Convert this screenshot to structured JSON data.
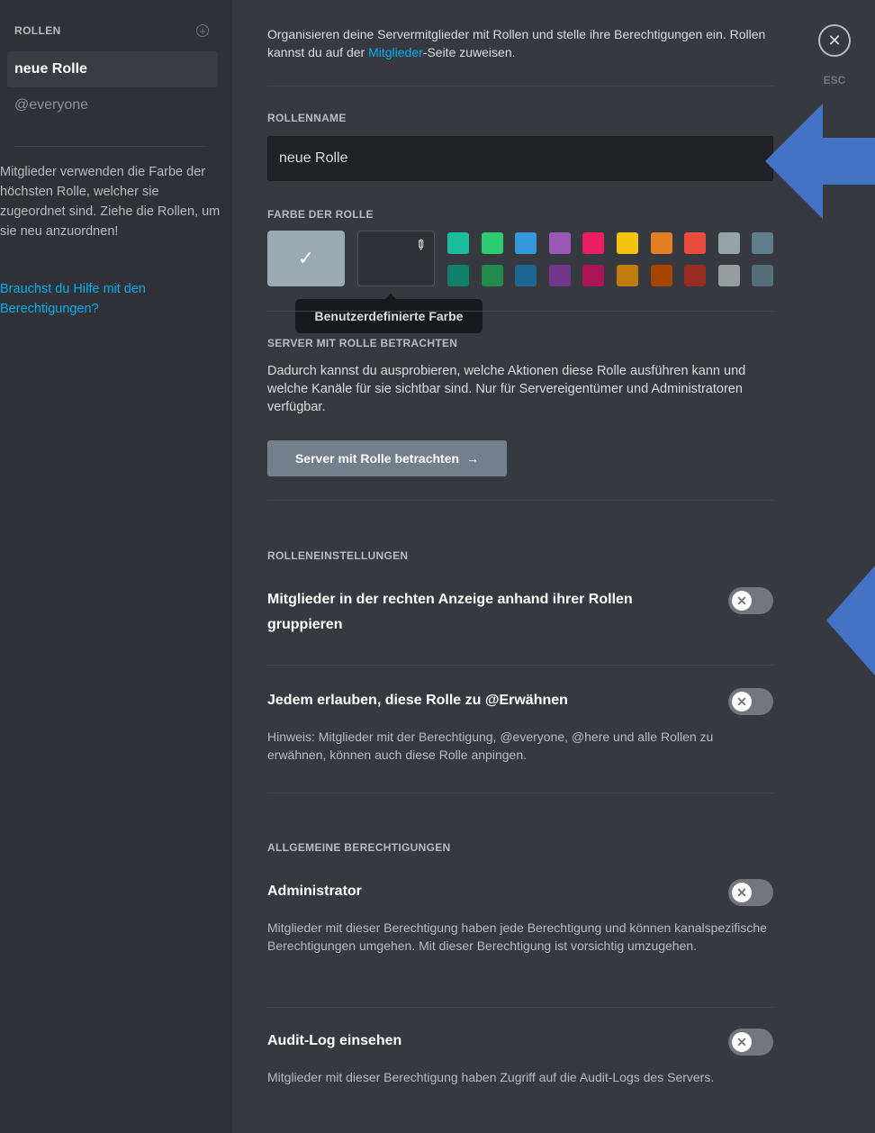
{
  "sidebar": {
    "title": "ROLLEN",
    "add_icon": "plus-circle-icon",
    "roles": [
      {
        "label": "neue Rolle",
        "active": true
      },
      {
        "label": "@everyone",
        "active": false
      }
    ],
    "help_text": "Mitglieder verwenden die Farbe der höchsten Rolle, welcher sie zugeordnet sind. Ziehe die Rollen, um sie neu anzuordnen!",
    "help_link": "Brauchst du Hilfe mit den Berechtigungen?"
  },
  "intro": {
    "text_before": "Organisieren deine Servermitglieder mit Rollen und stelle ihre Berechtigungen ein. Rollen kannst du auf der ",
    "link": "Mitglieder",
    "text_after": "-Seite zuweisen."
  },
  "role_name": {
    "label": "ROLLENNAME",
    "value": "neue Rolle"
  },
  "role_color": {
    "label": "FARBE DER ROLLE",
    "default_color": "#99aab5",
    "check_icon": "✓",
    "tooltip": "Benutzerdefinierte Farbe",
    "swatches_top": [
      "#1abc9c",
      "#2ecc71",
      "#3498db",
      "#9b59b6",
      "#e91e63",
      "#f1c40f",
      "#e67e22",
      "#e74c3c",
      "#95a5a6",
      "#607d8b"
    ],
    "swatches_bottom": [
      "#11806a",
      "#1f8b4c",
      "#206694",
      "#71368a",
      "#ad1457",
      "#c27c0e",
      "#a84300",
      "#992d22",
      "#979c9f",
      "#546e7a"
    ]
  },
  "view_as_role": {
    "label": "SERVER MIT ROLLE BETRACHTEN",
    "description": "Dadurch kannst du ausprobieren, welche Aktionen diese Rolle ausführen kann und welche Kanäle für sie sichtbar sind. Nur für Servereigentümer und Administratoren verfügbar.",
    "button": "Server mit Rolle betrachten",
    "button_arrow": "→"
  },
  "role_settings": {
    "label": "ROLLENEINSTELLUNGEN",
    "items": [
      {
        "title": "Mitglieder in der rechten Anzeige anhand ihrer Rollen gruppieren",
        "description": "",
        "enabled": false
      },
      {
        "title": "Jedem erlauben, diese Rolle zu @Erwähnen",
        "description": "Hinweis: Mitglieder mit der Berechtigung, @everyone, @here und alle Rollen zu erwähnen, können auch diese Rolle anpingen.",
        "enabled": false
      }
    ]
  },
  "general_permissions": {
    "label": "ALLGEMEINE BERECHTIGUNGEN",
    "items": [
      {
        "title": "Administrator",
        "description": "Mitglieder mit dieser Berechtigung haben jede Berechtigung und können kanalspezifische Berechtigungen umgehen. Mit dieser Berechtigung ist vorsichtig umzugehen.",
        "enabled": false
      },
      {
        "title": "Audit-Log einsehen",
        "description": "Mitglieder mit dieser Berechtigung haben Zugriff auf die Audit-Logs des Servers.",
        "enabled": false
      }
    ]
  },
  "toggle_off_glyph": "✕",
  "close": {
    "glyph": "✕",
    "label": "ESC"
  },
  "annotation_color": "#4472c4"
}
